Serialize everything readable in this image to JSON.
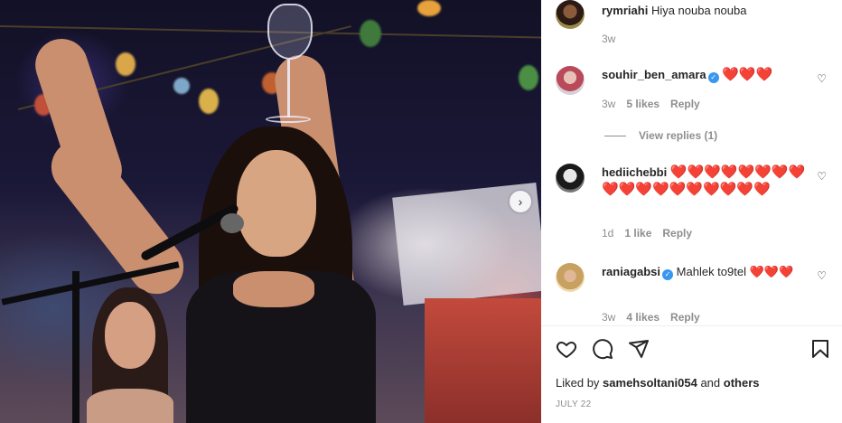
{
  "post": {
    "next_icon": "chevron-right-icon"
  },
  "comments": [
    {
      "username": "rymriahi",
      "text": "Hiya nouba nouba",
      "age": "3w",
      "verified": false
    },
    {
      "username": "souhir_ben_amara",
      "text": "❤️❤️❤️",
      "age": "3w",
      "likes": "5 likes",
      "reply": "Reply",
      "verified": true,
      "view_replies": "View replies (1)"
    },
    {
      "username": "hediichebbi",
      "text": "❤️❤️❤️❤️❤️❤️❤️❤️❤️❤️❤️❤️❤️❤️❤️❤️❤️❤️",
      "age": "1d",
      "likes": "1 like",
      "reply": "Reply",
      "verified": false
    },
    {
      "username": "raniagabsi",
      "text": "Mahlek to9tel ❤️❤️❤️",
      "age": "3w",
      "likes": "4 likes",
      "reply": "Reply",
      "verified": true
    }
  ],
  "actions": {
    "like_icon": "heart-icon",
    "comment_icon": "comment-icon",
    "share_icon": "share-icon",
    "save_icon": "bookmark-icon"
  },
  "liked_by": {
    "prefix": "Liked by",
    "user": "samehsoltani054",
    "and": "and",
    "others": "others"
  },
  "date": "JULY 22",
  "colors": {
    "heart": "#e0202c",
    "verified": "#3897f0",
    "meta": "#8e8e8e"
  }
}
